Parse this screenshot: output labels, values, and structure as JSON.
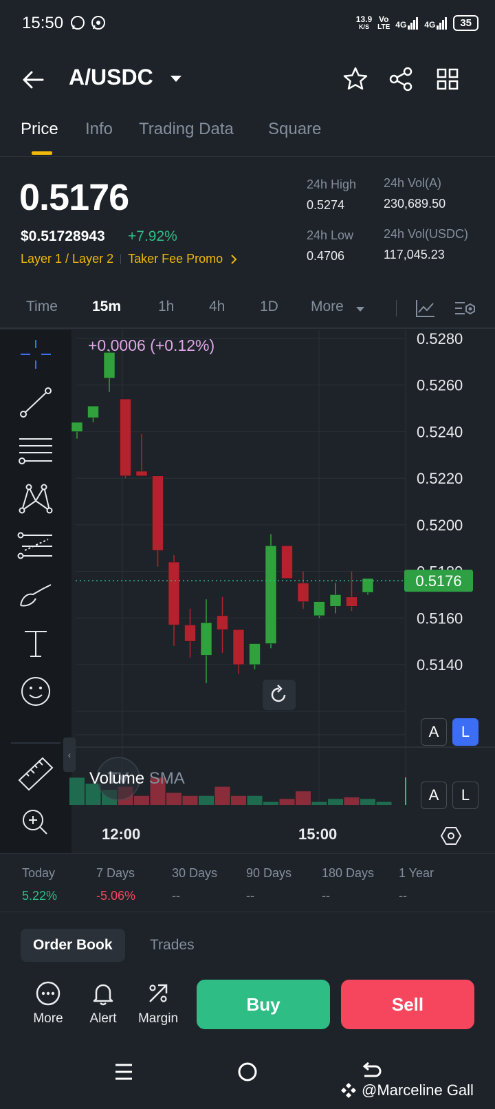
{
  "status_bar": {
    "time": "15:50",
    "net_speed": "13.9",
    "net_unit": "K/S",
    "volte": "Vo",
    "lte": "LTE",
    "sig1": "4G",
    "sig2": "4G",
    "battery": "35"
  },
  "header": {
    "pair": "A/USDC"
  },
  "tabs": [
    "Price",
    "Info",
    "Trading Data",
    "Square"
  ],
  "price": {
    "last": "0.5176",
    "usd": "$0.51728943",
    "change": "+7.92%",
    "tag1": "Layer 1 / Layer 2",
    "tag2": "Taker Fee Promo",
    "high_label": "24h High",
    "high": "0.5274",
    "low_label": "24h Low",
    "low": "0.4706",
    "vol_a_label": "24h Vol(A)",
    "vol_a": "230,689.50",
    "vol_usdc_label": "24h Vol(USDC)",
    "vol_usdc": "117,045.23"
  },
  "timeframes": [
    "Time",
    "15m",
    "1h",
    "4h",
    "1D",
    "More"
  ],
  "chart": {
    "change_label": "+0.0006 (+0.12%)",
    "price_ticks": [
      "0.5280",
      "0.5260",
      "0.5240",
      "0.5220",
      "0.5200",
      "0.5180",
      "0.5160",
      "0.5140"
    ],
    "current_price": "0.5176",
    "x_ticks": [
      "12:00",
      "15:00"
    ],
    "a_label": "A",
    "l_label": "L",
    "volume_label": "Volume",
    "volume_sma": "SMA",
    "tv_logo": "TV",
    "colors": {
      "up": "#2ebd85",
      "down": "#f6465d",
      "candle_up": "#30a13c",
      "candle_down": "#b4222e"
    }
  },
  "chart_data": {
    "type": "candlestick",
    "interval": "15m",
    "ylim": [
      0.5125,
      0.5285
    ],
    "candles": [
      {
        "o": 0.524,
        "h": 0.5244,
        "l": 0.5237,
        "c": 0.5244
      },
      {
        "o": 0.5246,
        "h": 0.525,
        "l": 0.5244,
        "c": 0.5251
      },
      {
        "o": 0.5263,
        "h": 0.5275,
        "l": 0.5257,
        "c": 0.5274
      },
      {
        "o": 0.5254,
        "h": 0.5254,
        "l": 0.522,
        "c": 0.5221
      },
      {
        "o": 0.5223,
        "h": 0.5239,
        "l": 0.5221,
        "c": 0.5221
      },
      {
        "o": 0.5221,
        "h": 0.5221,
        "l": 0.5182,
        "c": 0.5189
      },
      {
        "o": 0.5184,
        "h": 0.5187,
        "l": 0.5148,
        "c": 0.5157
      },
      {
        "o": 0.5157,
        "h": 0.5164,
        "l": 0.5143,
        "c": 0.515
      },
      {
        "o": 0.5144,
        "h": 0.5168,
        "l": 0.5132,
        "c": 0.5158
      },
      {
        "o": 0.5161,
        "h": 0.5169,
        "l": 0.5145,
        "c": 0.5155
      },
      {
        "o": 0.5155,
        "h": 0.5155,
        "l": 0.5136,
        "c": 0.514
      },
      {
        "o": 0.514,
        "h": 0.5149,
        "l": 0.5138,
        "c": 0.5149
      },
      {
        "o": 0.5149,
        "h": 0.5196,
        "l": 0.5147,
        "c": 0.5191
      },
      {
        "o": 0.5191,
        "h": 0.5191,
        "l": 0.5177,
        "c": 0.5177
      },
      {
        "o": 0.5175,
        "h": 0.518,
        "l": 0.5164,
        "c": 0.5167
      },
      {
        "o": 0.5161,
        "h": 0.5167,
        "l": 0.516,
        "c": 0.5167
      },
      {
        "o": 0.5165,
        "h": 0.5175,
        "l": 0.5162,
        "c": 0.517
      },
      {
        "o": 0.5169,
        "h": 0.518,
        "l": 0.5163,
        "c": 0.5165
      },
      {
        "o": 0.5171,
        "h": 0.5177,
        "l": 0.517,
        "c": 0.5177
      }
    ],
    "volumes": [
      0.9,
      0.7,
      0.5,
      0.6,
      0.3,
      0.9,
      0.4,
      0.3,
      0.3,
      0.6,
      0.3,
      0.3,
      0.1,
      0.2,
      0.45,
      0.1,
      0.2,
      0.25,
      0.2,
      0.1
    ]
  },
  "performance": [
    {
      "label": "Today",
      "value": "5.22%",
      "dir": "pos"
    },
    {
      "label": "7 Days",
      "value": "-5.06%",
      "dir": "neg"
    },
    {
      "label": "30 Days",
      "value": "--",
      "dir": "none"
    },
    {
      "label": "90 Days",
      "value": "--",
      "dir": "none"
    },
    {
      "label": "180 Days",
      "value": "--",
      "dir": "none"
    },
    {
      "label": "1 Year",
      "value": "--",
      "dir": "none"
    }
  ],
  "orderbook_tabs": [
    "Order Book",
    "Trades"
  ],
  "actions": {
    "more": "More",
    "alert": "Alert",
    "margin": "Margin",
    "buy": "Buy",
    "sell": "Sell"
  },
  "watermark": "@Marceline Gall"
}
